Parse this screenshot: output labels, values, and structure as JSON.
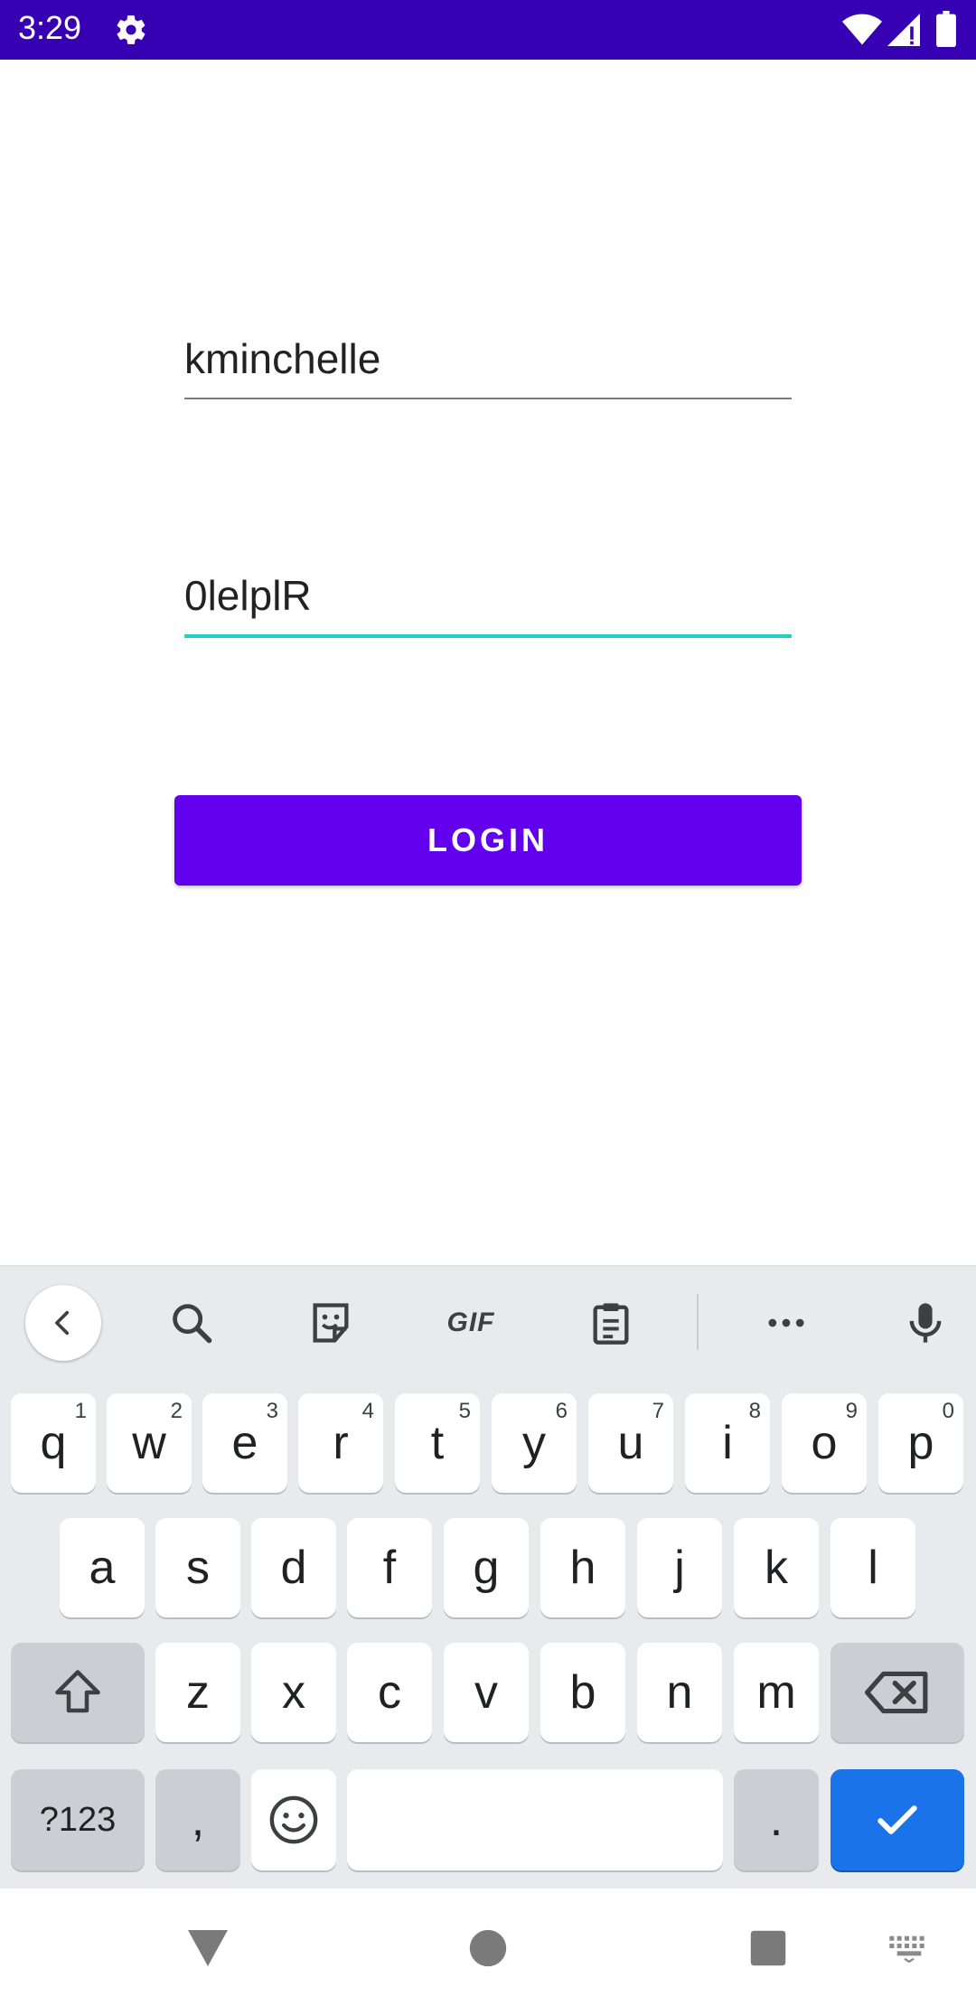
{
  "status_bar": {
    "time": "3:29",
    "icons": [
      "gear-icon",
      "wifi-icon",
      "signal-icon",
      "battery-icon"
    ]
  },
  "form": {
    "username_value": "kminchelle",
    "password_value": "0lelplR",
    "login_label": "LOGIN"
  },
  "colors": {
    "status_bar": "#3700B3",
    "accent": "#6200EE",
    "focus_underline": "#1FD2C6",
    "keyboard_action": "#1A73E8"
  },
  "keyboard": {
    "toolbar": [
      "back-icon",
      "search-icon",
      "sticker-icon",
      "gif-icon",
      "clipboard-icon",
      "more-icon",
      "mic-icon"
    ],
    "gif_label": "GIF",
    "row1": [
      {
        "k": "q",
        "h": "1"
      },
      {
        "k": "w",
        "h": "2"
      },
      {
        "k": "e",
        "h": "3"
      },
      {
        "k": "r",
        "h": "4"
      },
      {
        "k": "t",
        "h": "5"
      },
      {
        "k": "y",
        "h": "6"
      },
      {
        "k": "u",
        "h": "7"
      },
      {
        "k": "i",
        "h": "8"
      },
      {
        "k": "o",
        "h": "9"
      },
      {
        "k": "p",
        "h": "0"
      }
    ],
    "row2": [
      "a",
      "s",
      "d",
      "f",
      "g",
      "h",
      "j",
      "k",
      "l"
    ],
    "row3": [
      "z",
      "x",
      "c",
      "v",
      "b",
      "n",
      "m"
    ],
    "symbols_label": "?123",
    "comma_label": ",",
    "period_label": "."
  },
  "nav_bar": [
    "back-triangle-icon",
    "home-circle-icon",
    "recents-square-icon",
    "keyboard-switch-icon"
  ]
}
